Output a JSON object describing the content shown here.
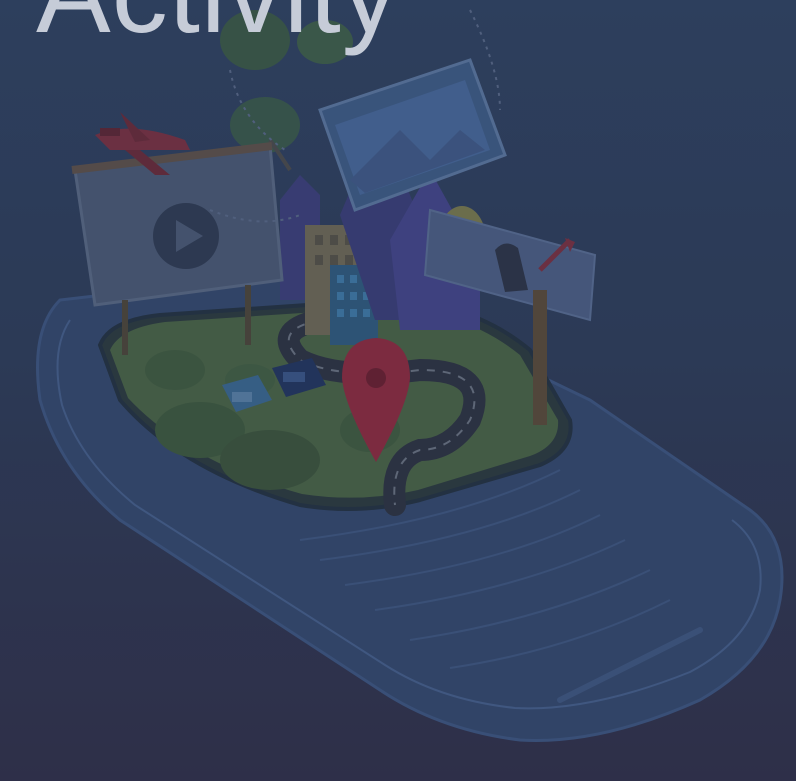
{
  "header": {
    "title": "Activity"
  },
  "colors": {
    "background_top": "#2f4261",
    "background_bottom": "#302f48",
    "title": "#c6ccd8",
    "accent_pin": "#b0304a"
  },
  "icons": [
    "play-icon",
    "map-pin-icon",
    "airplane-icon",
    "mailbox-icon"
  ]
}
